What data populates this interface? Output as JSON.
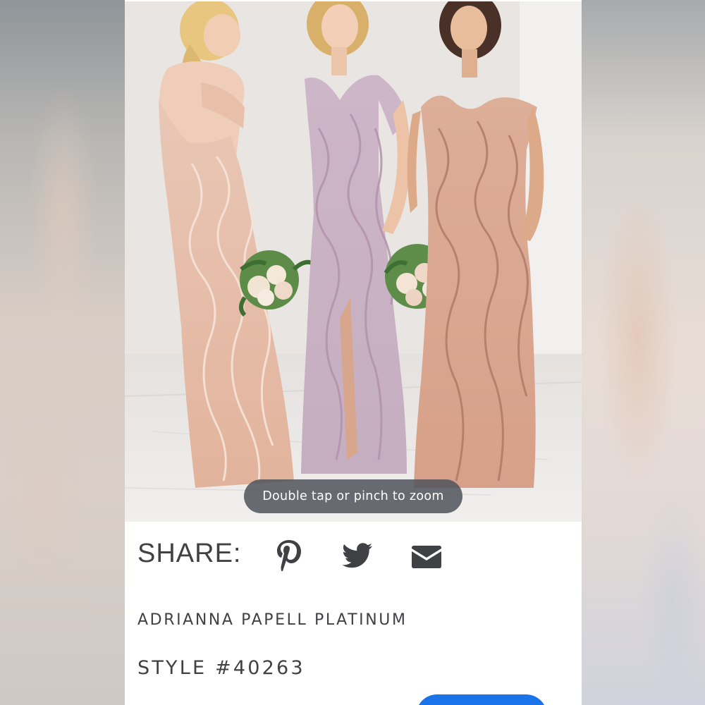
{
  "product": {
    "image_alt": "Three bridesmaids in beaded off-shoulder gowns holding bouquets",
    "zoom_hint": "Double tap or pinch to zoom",
    "share_label": "SHARE:",
    "share_icons": [
      "pinterest-icon",
      "twitter-icon",
      "email-icon"
    ],
    "brand": "ADRIANNA PAPELL PLATINUM",
    "style_number": "STYLE #40263"
  },
  "colors": {
    "text": "#3f4144",
    "accent_button": "#1a73e8",
    "zoom_hint_bg": "#50545c",
    "gown_blush": "#e3b9a4",
    "gown_lilac": "#c7afc2",
    "gown_rose": "#d9a58e"
  }
}
